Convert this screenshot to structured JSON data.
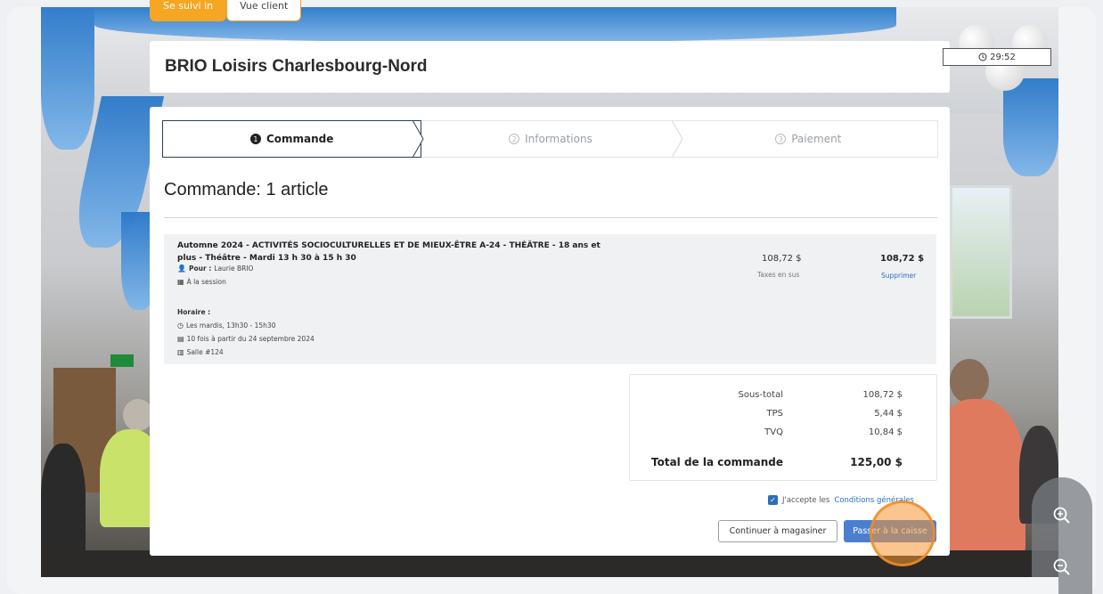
{
  "top_tabs": [
    {
      "label": "Se suivi in",
      "active": true
    },
    {
      "label": "Vue client",
      "active": false
    }
  ],
  "header": {
    "title": "BRIO Loisirs Charlesbourg-Nord"
  },
  "timer": {
    "icon": "clock-icon",
    "value": "29:52"
  },
  "stepper": {
    "steps": [
      {
        "number": "1",
        "label": "Commande",
        "active": true
      },
      {
        "number": "2",
        "label": "Informations",
        "active": false
      },
      {
        "number": "3",
        "label": "Paiement",
        "active": false
      }
    ]
  },
  "order": {
    "title": "Commande: 1 article",
    "item": {
      "title": "Automne 2024 - ACTIVITÉS SOCIOCULTURELLES ET DE MIEUX-ÊTRE A-24 - THÉÂTRE - 18 ans et plus - Théâtre - Mardi 13 h 30 à 15 h 30",
      "for_label": "Pour :",
      "for_value": "Laurie BRIO",
      "session": "À la session",
      "schedule_label": "Horaire :",
      "schedule_time": "Les mardis, 13h30 - 15h30",
      "schedule_dates": "10 fois à partir du 24 septembre 2024",
      "room": "Salle #124",
      "unit_price": "108,72 $",
      "taxes_note": "Taxes en sus",
      "line_total": "108,72 $",
      "remove_label": "Supprimer"
    }
  },
  "totals": {
    "rows": [
      {
        "label": "Sous-total",
        "value": "108,72 $"
      },
      {
        "label": "TPS",
        "value": "5,44 $"
      },
      {
        "label": "TVQ",
        "value": "10,84 $"
      }
    ],
    "grand_label": "Total de la commande",
    "grand_value": "125,00 $"
  },
  "terms": {
    "checked": true,
    "text": "J'accepte les",
    "link": "Conditions générales"
  },
  "actions": {
    "continue_label": "Continuer à magasiner",
    "checkout_label": "Passer à la caisse"
  },
  "colors": {
    "accent_orange": "#f5a623",
    "primary_blue": "#4a7fd0",
    "link_blue": "#2a6ebb",
    "drape_blue": "#2a78c9"
  },
  "zoom": {
    "in_icon": "zoom-in-icon",
    "out_icon": "zoom-out-icon"
  }
}
